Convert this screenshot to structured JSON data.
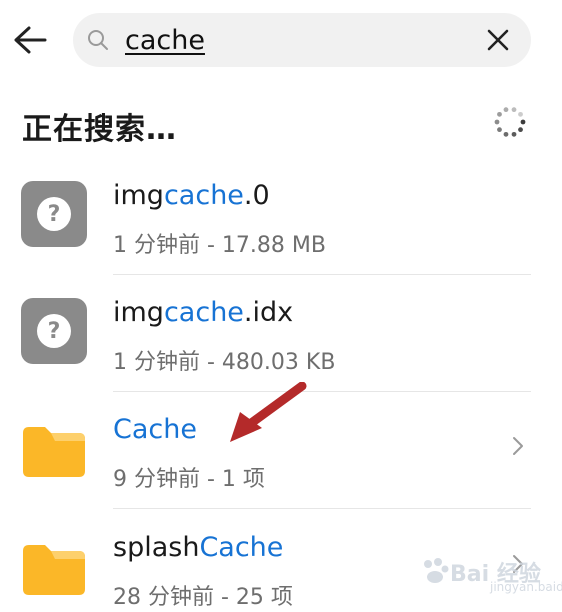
{
  "search": {
    "value": "cache",
    "back_icon": "arrow-left-icon",
    "search_icon": "search-icon",
    "clear_icon": "close-icon"
  },
  "status": {
    "text": "正在搜索…",
    "spinner_icon": "loading-spinner-icon"
  },
  "results": [
    {
      "type": "unknown-file",
      "name_prefix": "img",
      "name_match": "cache",
      "name_suffix": ".0",
      "meta": "1 分钟前 - 17.88 MB",
      "icon": "unknown-file-icon"
    },
    {
      "type": "unknown-file",
      "name_prefix": "img",
      "name_match": "cache",
      "name_suffix": ".idx",
      "meta": "1 分钟前 - 480.03 KB",
      "icon": "unknown-file-icon"
    },
    {
      "type": "folder",
      "name_prefix": "",
      "name_match": "Cache",
      "name_suffix": "",
      "meta": "9 分钟前 - 1 项",
      "icon": "folder-icon"
    },
    {
      "type": "folder",
      "name_prefix": "splash",
      "name_match": "Cache",
      "name_suffix": "",
      "meta": "28 分钟前 - 25 项",
      "icon": "folder-icon"
    }
  ],
  "watermark": {
    "brand": "Bai 经验",
    "sub": "jingyan.baidu.com"
  },
  "colors": {
    "highlight": "#1773d4",
    "folder": "#fbb728",
    "folder_tab": "#fdd06c",
    "unknown_icon_bg": "#8a8a8a",
    "annotation_arrow": "#b42a2a"
  }
}
